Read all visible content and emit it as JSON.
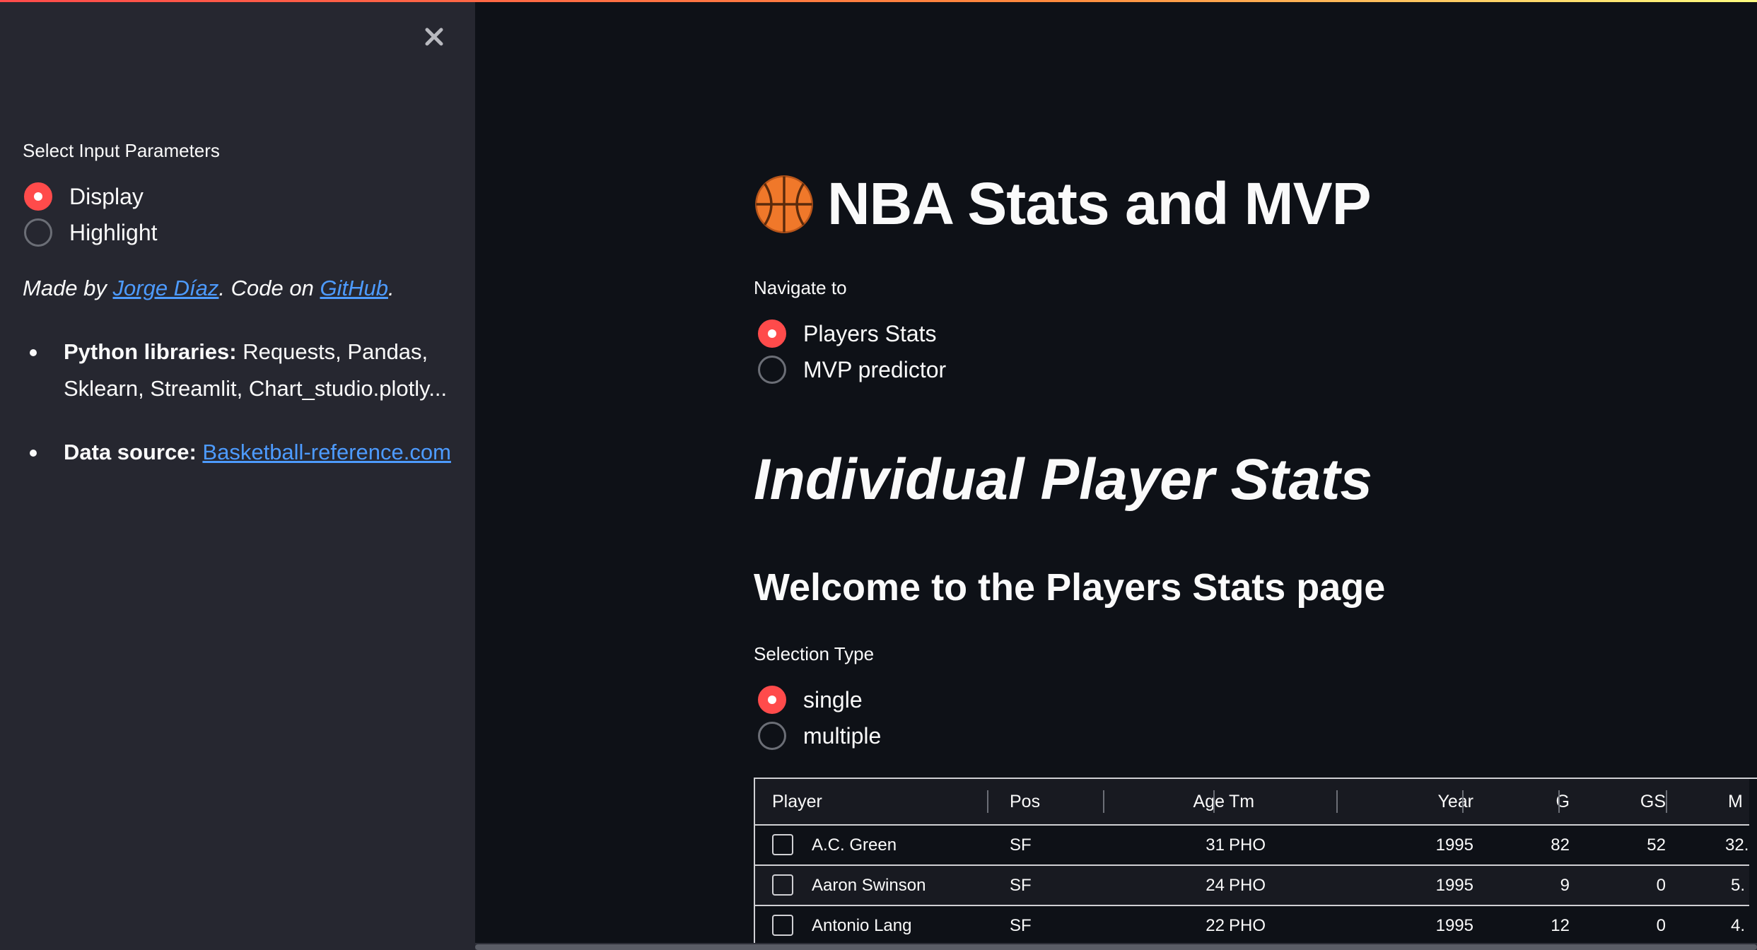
{
  "sidebar": {
    "label": "Select Input Parameters",
    "options": [
      {
        "label": "Display",
        "selected": true
      },
      {
        "label": "Highlight",
        "selected": false
      }
    ],
    "made_by_prefix": "Made by ",
    "author": "Jorge Díaz",
    "code_on": ". Code on ",
    "github": "GitHub",
    "period": ".",
    "libraries_label": "Python libraries:",
    "libraries_text": " Requests, Pandas, Sklearn, Streamlit, Chart_studio.plotly...",
    "source_label": "Data source:",
    "source_link": "Basketball-reference.com"
  },
  "main": {
    "title": "NBA Stats and MVP",
    "title_icon": "basketball-icon",
    "nav_label": "Navigate to",
    "nav_options": [
      {
        "label": "Players Stats",
        "selected": true
      },
      {
        "label": "MVP predictor",
        "selected": false
      }
    ],
    "page_title": "Individual Player Stats",
    "welcome": "Welcome to the Players Stats page",
    "selection_label": "Selection Type",
    "selection_options": [
      {
        "label": "single",
        "selected": true
      },
      {
        "label": "multiple",
        "selected": false
      }
    ]
  },
  "table": {
    "columns": [
      "Player",
      "Pos",
      "Age",
      "Tm",
      "Year",
      "G",
      "GS",
      "M"
    ],
    "rows": [
      {
        "player": "A.C. Green",
        "pos": "SF",
        "age": "31",
        "tm": "PHO",
        "year": "1995",
        "g": "82",
        "gs": "52",
        "mp": "32."
      },
      {
        "player": "Aaron Swinson",
        "pos": "SF",
        "age": "24",
        "tm": "PHO",
        "year": "1995",
        "g": "9",
        "gs": "0",
        "mp": "5."
      },
      {
        "player": "Antonio Lang",
        "pos": "SF",
        "age": "22",
        "tm": "PHO",
        "year": "1995",
        "g": "12",
        "gs": "0",
        "mp": "4."
      }
    ]
  },
  "colors": {
    "accent": "#ff4b4b",
    "link": "#4d9bff",
    "background": "#0e1117",
    "sidebar": "#262730"
  }
}
